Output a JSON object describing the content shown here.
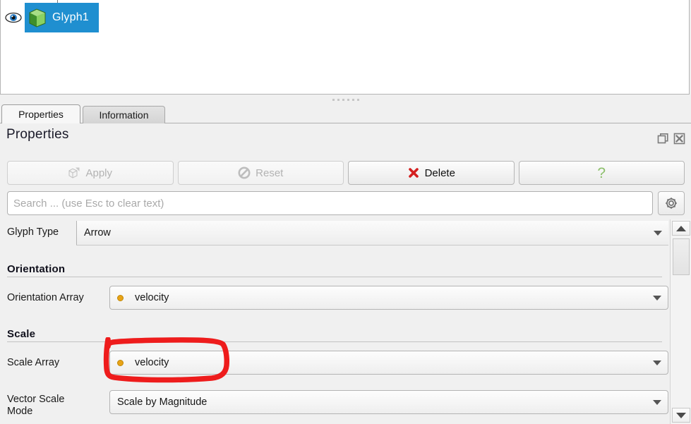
{
  "pipeline": {
    "items": [
      {
        "label": "Glyph1",
        "visibility_icon": "eye-icon",
        "type_icon": "green-cube-icon",
        "selected": true
      }
    ]
  },
  "tabs": [
    {
      "label": "Properties",
      "active": true
    },
    {
      "label": "Information",
      "active": false
    }
  ],
  "panel": {
    "title": "Properties",
    "restore_icon": "undock-icon",
    "close_icon": "close-icon"
  },
  "actions": [
    {
      "label": "Apply",
      "icon": "apply-cube-icon",
      "enabled": false
    },
    {
      "label": "Reset",
      "icon": "reset-prohibited-icon",
      "enabled": false
    },
    {
      "label": "Delete",
      "icon": "delete-x-icon",
      "enabled": true
    },
    {
      "label": "?",
      "icon": "help-question-icon",
      "enabled": true
    }
  ],
  "search": {
    "value": "",
    "placeholder": "Search ... (use Esc to clear text)",
    "settings_icon": "gear-icon"
  },
  "form": {
    "glyph_type": {
      "label": "Glyph Type",
      "value": "Arrow"
    },
    "orientation_group": {
      "title": "Orientation",
      "array": {
        "label": "Orientation Array",
        "value": "velocity",
        "icon": "point-data-dot-icon"
      }
    },
    "scale_group": {
      "title": "Scale",
      "array": {
        "label": "Scale Array",
        "value": "velocity",
        "icon": "point-data-dot-icon",
        "annotated": true
      },
      "vector_scale_mode": {
        "label_line1": "Vector Scale",
        "label_line2": "Mode",
        "value": "Scale by Magnitude"
      }
    }
  },
  "scrollbar": {
    "up_icon": "scroll-up-arrow-icon",
    "down_icon": "scroll-down-arrow-icon"
  },
  "annotation": {
    "shape": "hand-drawn-red-ellipse",
    "color": "#ee1c1c",
    "target": "Scale Array combo box"
  }
}
